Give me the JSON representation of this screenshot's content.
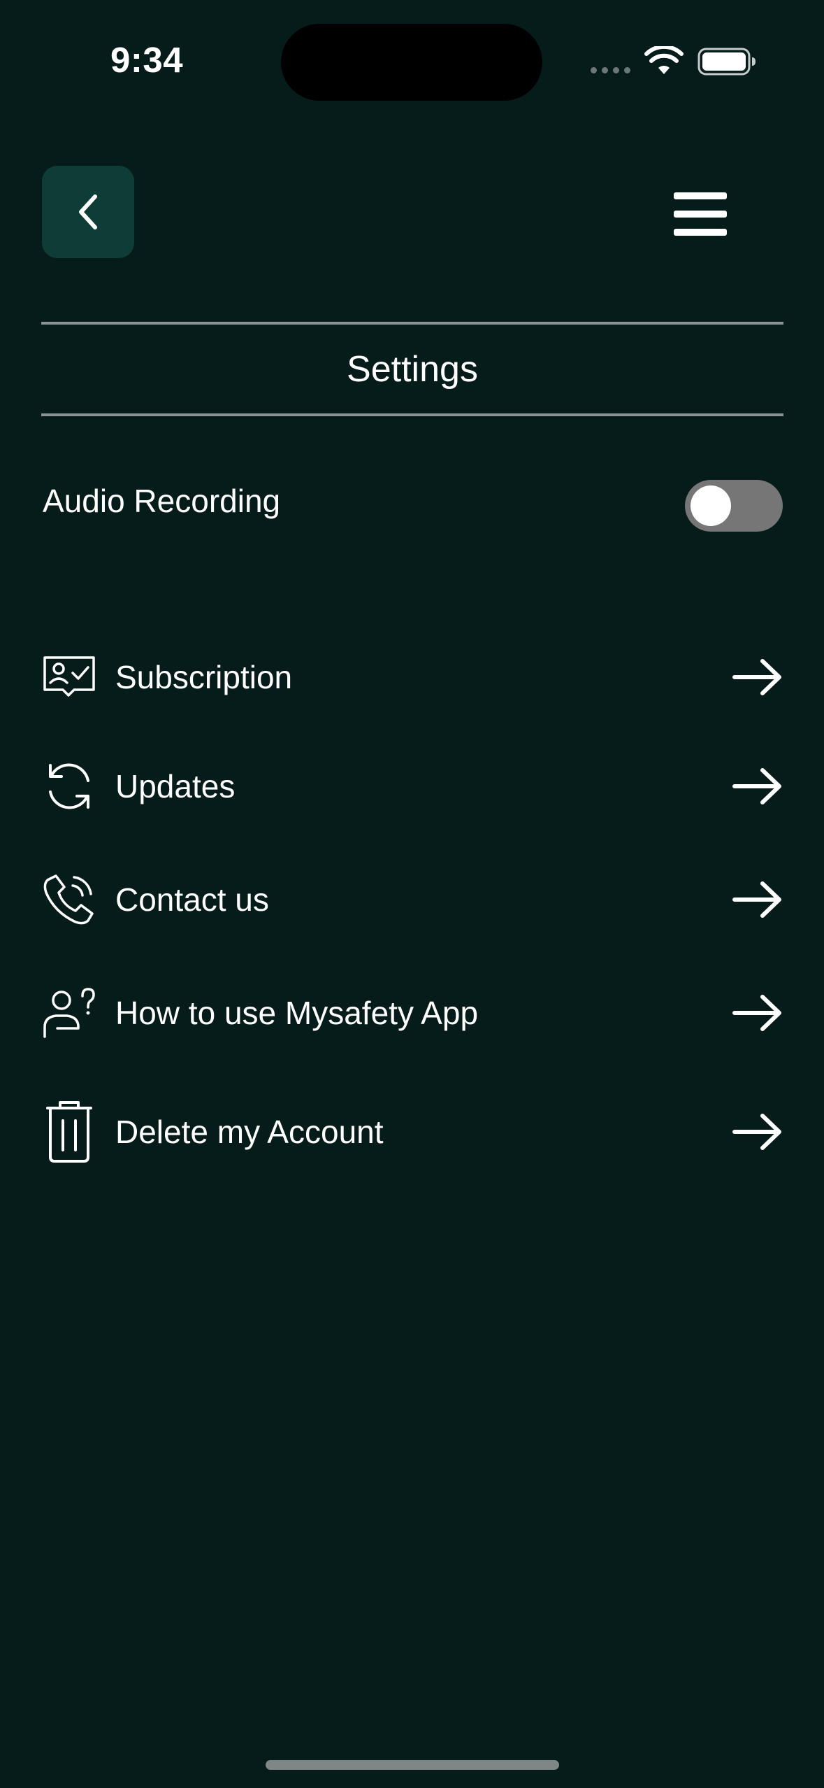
{
  "status_bar": {
    "time": "9:34"
  },
  "header": {
    "back_icon": "chevron-left-icon",
    "menu_icon": "hamburger-menu-icon",
    "title": "Settings"
  },
  "audio_recording": {
    "label": "Audio Recording",
    "enabled": false
  },
  "menu": {
    "items": [
      {
        "label": "Subscription",
        "icon": "subscription-icon"
      },
      {
        "label": "Updates",
        "icon": "refresh-icon"
      },
      {
        "label": "Contact us",
        "icon": "phone-icon"
      },
      {
        "label": "How to use Mysafety App",
        "icon": "user-help-icon"
      },
      {
        "label": "Delete my Account",
        "icon": "trash-icon"
      }
    ]
  },
  "colors": {
    "background": "#061c1a",
    "back_button": "#0e3d37",
    "divider": "#8a9593",
    "toggle_off": "#767676",
    "text": "#ffffff"
  }
}
